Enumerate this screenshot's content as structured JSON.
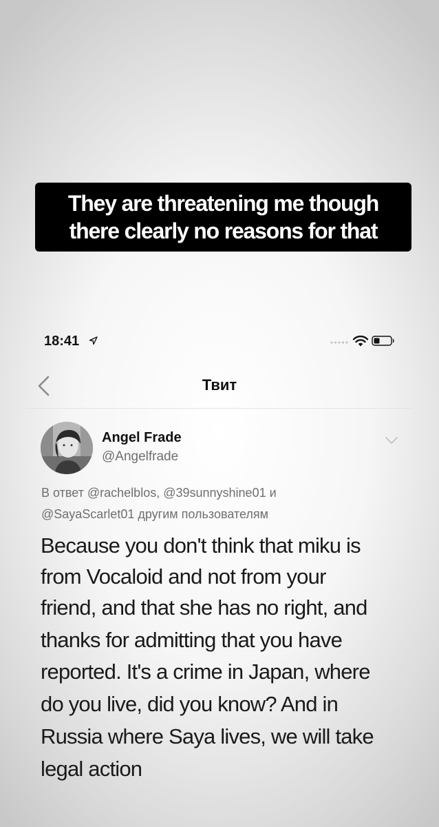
{
  "caption": {
    "lines": [
      "They are threatening me though",
      "there clearly no reasons for that"
    ]
  },
  "status_bar": {
    "time": "18:41"
  },
  "nav": {
    "title": "Твит"
  },
  "tweet": {
    "author_name": "Angel Frade",
    "author_handle": "@Angelfrade",
    "reply_to_lines": [
      "В ответ @rachelblos, @39sunnyshine01 и",
      "@SayaScarlet01 другим пользователям"
    ],
    "text_lines": [
      "Because you don't think that miku is",
      "from Vocaloid and not from your",
      "friend, and that she has no right, and",
      "thanks for admitting that you have",
      "reported. It's a crime in Japan, where",
      "do you live, did you know? And in",
      "Russia where Saya lives, we will take",
      "legal action"
    ]
  }
}
